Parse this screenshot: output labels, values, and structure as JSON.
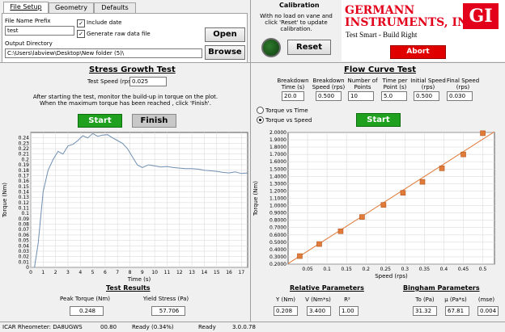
{
  "tabs": [
    "File Setup",
    "Geometry",
    "Defaults"
  ],
  "file_setup": {
    "prefix_label": "File Name Prefix",
    "prefix_value": "test",
    "include_date_label": "Include date",
    "raw_data_label": "Generate raw data file",
    "output_dir_label": "Output Directory",
    "output_dir_value": "C:\\Users\\labview\\Desktop\\New folder (5)\\",
    "open_label": "Open",
    "browse_label": "Browse"
  },
  "calibration": {
    "title": "Calibration",
    "instructions": "With no load on vane and click 'Reset' to update calibration.",
    "reset_label": "Reset"
  },
  "brand": {
    "name_line1": "GERMANN",
    "name_line2": "INSTRUMENTS, INC.",
    "tagline": "Test Smart - Build Right",
    "logo_text": "GI",
    "abort_label": "Abort",
    "color": "#e3001b"
  },
  "stress_growth": {
    "title": "Stress Growth Test",
    "speed_label": "Test Speed (rps)",
    "speed_value": "0.025",
    "instructions_1": "After starting the test, monitor the build-up in torque on the plot.",
    "instructions_2": "When the maximum torque has been reached , click 'Finish'.",
    "start_label": "Start",
    "finish_label": "Finish",
    "results_title": "Test Results",
    "peak_label": "Peak Torque (Nm)",
    "peak_value": "0.248",
    "yield_label": "Yield Stress (Pa)",
    "yield_value": "57.706"
  },
  "flow_curve": {
    "title": "Flow Curve Test",
    "params": [
      {
        "label1": "Breakdown",
        "label2": "Time (s)",
        "value": "20.0"
      },
      {
        "label1": "Breakdown",
        "label2": "Speed (rps)",
        "value": "0.500"
      },
      {
        "label1": "Number of",
        "label2": "Points",
        "value": "10"
      },
      {
        "label1": "Time per",
        "label2": "Point (s)",
        "value": "5.0"
      },
      {
        "label1": "Initial Speed",
        "label2": "(rps)",
        "value": "0.500"
      },
      {
        "label1": "Final Speed",
        "label2": "(rps)",
        "value": "0.030"
      }
    ],
    "radio_time": "Torque vs Time",
    "radio_speed": "Torque vs Speed",
    "start_label": "Start",
    "relative_title": "Relative Parameters",
    "relative": [
      {
        "label": "Y (Nm)",
        "value": "0.208"
      },
      {
        "label": "V (Nm*s)",
        "value": "3.400"
      },
      {
        "label": "R²",
        "value": "1.00"
      }
    ],
    "bingham_title": "Bingham Parameters",
    "bingham": [
      {
        "label": "To (Pa)",
        "value": "31.32"
      },
      {
        "label": "μ (Pa*s)",
        "value": "67.81"
      },
      {
        "label": "(mse)",
        "value": "0.004"
      }
    ]
  },
  "status_bar": {
    "device": "ICAR Rheometer: DA8UGWS",
    "value": "00.80",
    "ready1": "Ready (0.34%)",
    "ready2": "Ready",
    "version": "3.0.0.78"
  },
  "chart_data": [
    {
      "type": "line",
      "xlabel": "Time (s)",
      "ylabel": "Torque (Nm)",
      "xlim": [
        0,
        17.5
      ],
      "ylim": [
        0,
        0.25
      ],
      "xticks": [
        0,
        1,
        2,
        3,
        4,
        5,
        6,
        7,
        8,
        9,
        10,
        11,
        12,
        13,
        14,
        15,
        16,
        17
      ],
      "yticks": [
        0,
        0.01,
        0.02,
        0.03,
        0.04,
        0.05,
        0.06,
        0.07,
        0.08,
        0.09,
        0.1,
        0.11,
        0.12,
        0.13,
        0.14,
        0.15,
        0.16,
        0.17,
        0.18,
        0.19,
        0.2,
        0.21,
        0.22,
        0.23,
        0.24
      ],
      "grid": true,
      "color": "#6f8fb0",
      "x": [
        0.3,
        0.6,
        1.0,
        1.4,
        1.8,
        2.2,
        2.6,
        3.0,
        3.4,
        3.8,
        4.2,
        4.6,
        5.0,
        5.4,
        5.8,
        6.2,
        6.6,
        7.0,
        7.4,
        7.8,
        8.2,
        8.6,
        9.0,
        9.5,
        10.0,
        10.5,
        11.0,
        11.5,
        12.0,
        12.5,
        13.0,
        13.5,
        14.0,
        14.5,
        15.0,
        15.5,
        16.0,
        16.5,
        17.0,
        17.5
      ],
      "y": [
        0.0,
        0.045,
        0.14,
        0.18,
        0.2,
        0.215,
        0.21,
        0.225,
        0.228,
        0.235,
        0.244,
        0.24,
        0.248,
        0.243,
        0.245,
        0.246,
        0.24,
        0.235,
        0.23,
        0.22,
        0.205,
        0.19,
        0.185,
        0.19,
        0.188,
        0.186,
        0.187,
        0.185,
        0.184,
        0.183,
        0.183,
        0.182,
        0.18,
        0.179,
        0.178,
        0.176,
        0.175,
        0.177,
        0.174,
        0.175
      ]
    },
    {
      "type": "scatter",
      "xlabel": "Speed (rps)",
      "ylabel": "Torque (Nm)",
      "xlim": [
        0,
        0.53
      ],
      "ylim": [
        0.2,
        2.0
      ],
      "xticks": [
        0.05,
        0.1,
        0.15,
        0.2,
        0.25,
        0.3,
        0.35,
        0.4,
        0.45,
        0.5
      ],
      "yticks": [
        0.2,
        0.3,
        0.4,
        0.5,
        0.6,
        0.7,
        0.8,
        0.9,
        1.0,
        1.1,
        1.2,
        1.3,
        1.4,
        1.5,
        1.6,
        1.7,
        1.8,
        1.9,
        2.0
      ],
      "ytick_labels": [
        "0.2000",
        "0.3000",
        "0.4000",
        "0.5000",
        "0.6000",
        "0.7000",
        "0.8000",
        "0.9000",
        "1.0000",
        "1.1000",
        "1.2000",
        "1.3000",
        "1.4000",
        "1.5000",
        "1.6000",
        "1.7000",
        "1.8000",
        "1.9000",
        "2.0000"
      ],
      "grid": true,
      "marker_color": "#e07b39",
      "fit_color": "#e07b39",
      "x": [
        0.03,
        0.08,
        0.135,
        0.19,
        0.245,
        0.295,
        0.345,
        0.395,
        0.45,
        0.5
      ],
      "y": [
        0.31,
        0.475,
        0.65,
        0.845,
        1.01,
        1.175,
        1.325,
        1.51,
        1.7,
        1.99
      ],
      "fit": {
        "intercept": 0.208,
        "slope": 3.4,
        "x_range": [
          0.0,
          0.53
        ]
      }
    }
  ]
}
